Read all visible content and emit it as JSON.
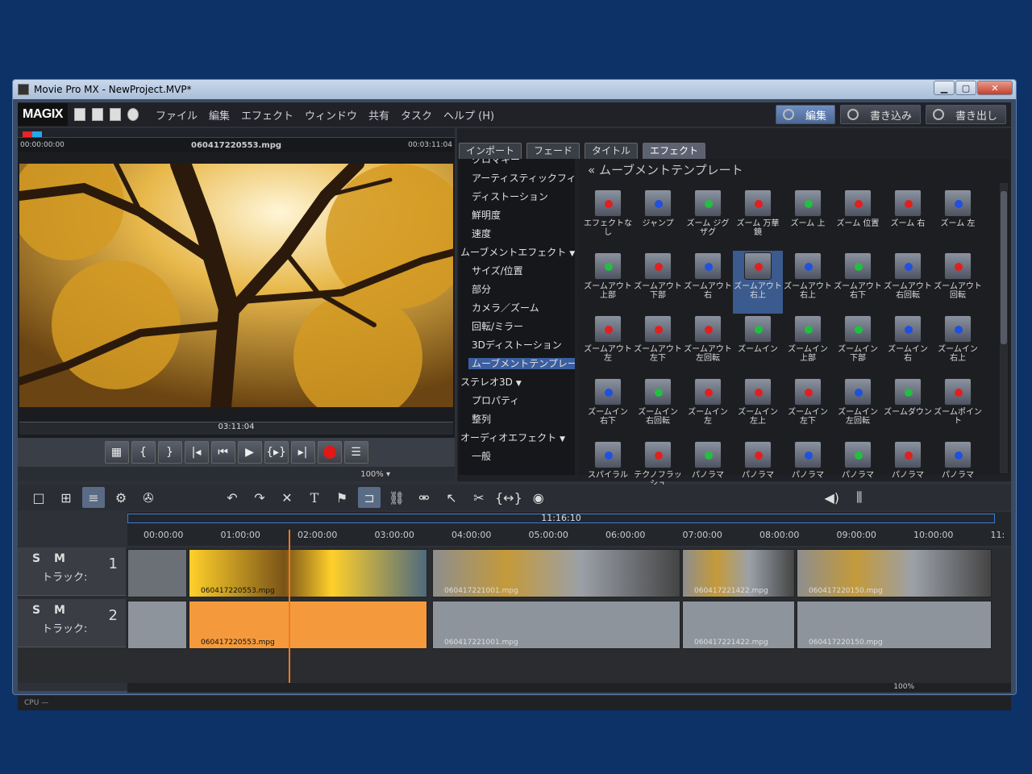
{
  "window": {
    "title": "Movie Pro MX - NewProject.MVP*"
  },
  "menubar": {
    "logo": "MAGIX",
    "menus": [
      "ファイル",
      "編集",
      "エフェクト",
      "ウィンドウ",
      "共有",
      "タスク",
      "ヘルプ (H)"
    ],
    "modes": [
      {
        "label": "編集",
        "active": true
      },
      {
        "label": "書き込み",
        "active": false
      },
      {
        "label": "書き出し",
        "active": false
      }
    ]
  },
  "preview": {
    "time_start": "00:00:00:00",
    "filename": "060417220553.mpg",
    "time_end": "00:03:11:04",
    "position": "03:11:04",
    "zoom": "100%"
  },
  "effects": {
    "tabs": [
      {
        "label": "インポート",
        "active": false
      },
      {
        "label": "フェード",
        "active": false
      },
      {
        "label": "タイトル",
        "active": false
      },
      {
        "label": "エフェクト",
        "active": true
      }
    ],
    "categories": [
      {
        "label": "クロマキー",
        "level": 1
      },
      {
        "label": "アーティスティックフィルタ",
        "level": 1
      },
      {
        "label": "ディストーション",
        "level": 1
      },
      {
        "label": "鮮明度",
        "level": 1
      },
      {
        "label": "速度",
        "level": 1
      },
      {
        "label": "ムーブメントエフェクト",
        "level": 0,
        "dropdown": true
      },
      {
        "label": "サイズ/位置",
        "level": 1
      },
      {
        "label": "部分",
        "level": 1
      },
      {
        "label": "カメラ／ズーム",
        "level": 1
      },
      {
        "label": "回転/ミラー",
        "level": 1
      },
      {
        "label": "3Dディストーション",
        "level": 1
      },
      {
        "label": "ムーブメントテンプレート",
        "level": 1,
        "selected": true
      },
      {
        "label": "ステレオ3D",
        "level": 0,
        "dropdown": true
      },
      {
        "label": "プロパティ",
        "level": 1
      },
      {
        "label": "整列",
        "level": 1
      },
      {
        "label": "オーディオエフェクト",
        "level": 0,
        "dropdown": true
      },
      {
        "label": "一般",
        "level": 1
      }
    ],
    "panel_title": "ムーブメントテンプレート",
    "items": [
      {
        "label": "エフェクトなし",
        "dot": "#e02020"
      },
      {
        "label": "ジャンプ",
        "dot": "#2050e0"
      },
      {
        "label": "ズーム ジグザグ",
        "dot": "#20c040"
      },
      {
        "label": "ズーム 万華鏡",
        "dot": "#e02020"
      },
      {
        "label": "ズーム 上",
        "dot": "#20c040"
      },
      {
        "label": "ズーム 位置",
        "dot": "#e02020"
      },
      {
        "label": "ズーム 右",
        "dot": "#e02020"
      },
      {
        "label": "ズーム 左",
        "dot": "#2050e0"
      },
      {
        "label": "ズームアウト 上部",
        "dot": "#20c040"
      },
      {
        "label": "ズームアウト 下部",
        "dot": "#e02020"
      },
      {
        "label": "ズームアウト 右",
        "dot": "#2050e0"
      },
      {
        "label": "ズームアウト 右上",
        "dot": "#e02020",
        "selected": true
      },
      {
        "label": "ズームアウト 右上",
        "dot": "#2050e0"
      },
      {
        "label": "ズームアウト 右下",
        "dot": "#20c040"
      },
      {
        "label": "ズームアウト 右回転",
        "dot": "#2050e0"
      },
      {
        "label": "ズームアウト 回転",
        "dot": "#e02020"
      },
      {
        "label": "ズームアウト 左",
        "dot": "#e02020"
      },
      {
        "label": "ズームアウト 左下",
        "dot": "#e02020"
      },
      {
        "label": "ズームアウト 左回転",
        "dot": "#e02020"
      },
      {
        "label": "ズームイン",
        "dot": "#20c040"
      },
      {
        "label": "ズームイン 上部",
        "dot": "#20c040"
      },
      {
        "label": "ズームイン 下部",
        "dot": "#20c040"
      },
      {
        "label": "ズームイン 右",
        "dot": "#2050e0"
      },
      {
        "label": "ズームイン 右上",
        "dot": "#2050e0"
      },
      {
        "label": "ズームイン 右下",
        "dot": "#2050e0"
      },
      {
        "label": "ズームイン 右回転",
        "dot": "#20c040"
      },
      {
        "label": "ズームイン 左",
        "dot": "#e02020"
      },
      {
        "label": "ズームイン 左上",
        "dot": "#e02020"
      },
      {
        "label": "ズームイン 左下",
        "dot": "#e02020"
      },
      {
        "label": "ズームイン 左回転",
        "dot": "#2050e0"
      },
      {
        "label": "ズームダウン",
        "dot": "#20c040"
      },
      {
        "label": "ズームポイント",
        "dot": "#e02020"
      },
      {
        "label": "スパイラル",
        "dot": "#2050e0"
      },
      {
        "label": "テクノフラッシュ",
        "dot": "#e02020"
      },
      {
        "label": "パノラマ",
        "dot": "#20c040"
      },
      {
        "label": "パノラマ",
        "dot": "#e02020"
      },
      {
        "label": "パノラマ",
        "dot": "#2050e0"
      },
      {
        "label": "パノラマ",
        "dot": "#20c040"
      },
      {
        "label": "パノラマ",
        "dot": "#e02020"
      },
      {
        "label": "パノラマ",
        "dot": "#2050e0"
      }
    ]
  },
  "timeline": {
    "total": "11:16:10",
    "ticks": [
      "00:00:00",
      "01:00:00",
      "02:00:00",
      "03:00:00",
      "04:00:00",
      "05:00:00",
      "06:00:00",
      "07:00:00",
      "08:00:00",
      "09:00:00",
      "10:00:00",
      "11:"
    ],
    "tracks": [
      {
        "smb": "S M",
        "num": "1",
        "label": "トラック:"
      },
      {
        "smb": "S M",
        "num": "2",
        "label": "トラック:"
      }
    ],
    "video_clips": [
      "060417220553.mpg",
      "060417221001.mpg",
      "060417221422.mpg",
      "060417220150.mpg"
    ],
    "audio_clips": [
      "060417220553.mpg",
      "060417221001.mpg",
      "060417221422.mpg",
      "060417220150.mpg"
    ],
    "zoom": "100%"
  },
  "status": {
    "cpu": "CPU —"
  }
}
